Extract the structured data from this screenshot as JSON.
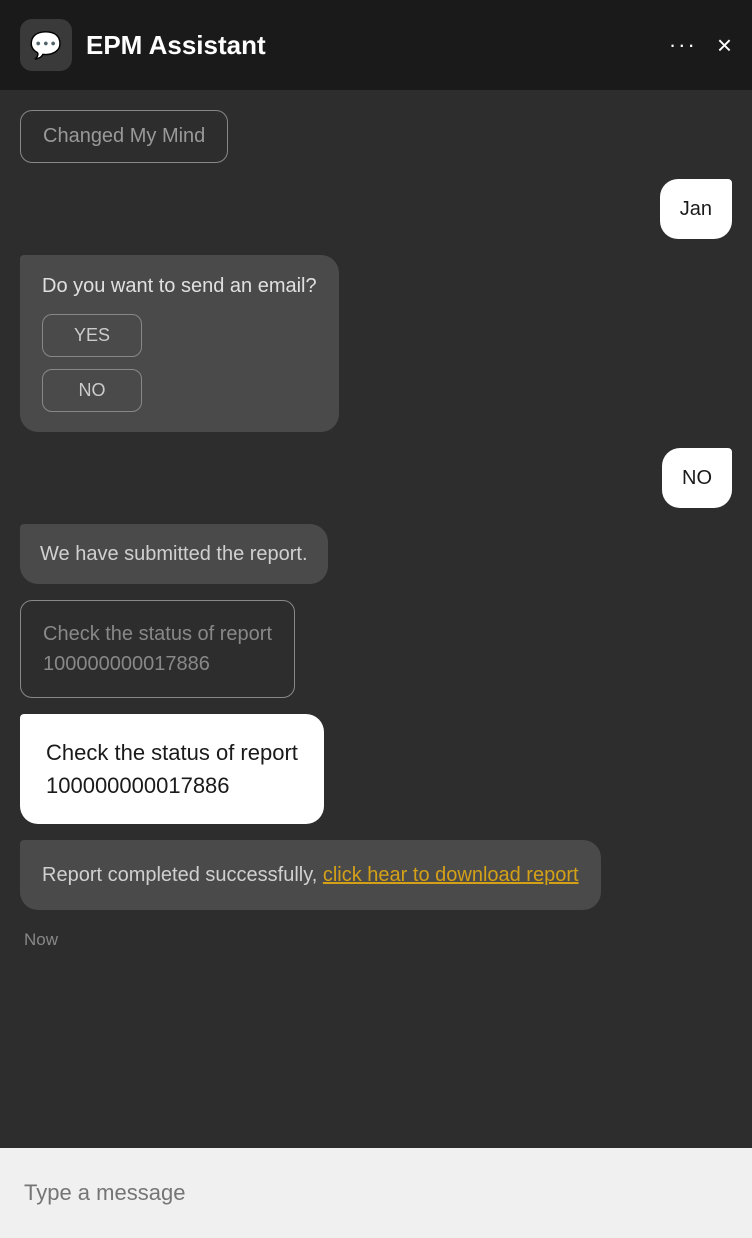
{
  "header": {
    "title": "EPM Assistant",
    "icon_label": "chat-icon",
    "dots_label": "···",
    "close_label": "×"
  },
  "messages": [
    {
      "id": "changed-mind",
      "type": "user-button",
      "text": "Changed My Mind",
      "side": "left"
    },
    {
      "id": "jan-reply",
      "type": "user-bubble",
      "text": "Jan",
      "side": "right"
    },
    {
      "id": "email-question",
      "type": "assistant-question",
      "question": "Do you want to send an email?",
      "options": [
        "YES",
        "NO"
      ],
      "side": "left"
    },
    {
      "id": "no-reply",
      "type": "user-bubble",
      "text": "NO",
      "side": "right"
    },
    {
      "id": "submitted-report",
      "type": "assistant-bubble",
      "text": "We have submitted the report.",
      "side": "left"
    },
    {
      "id": "check-status-outlined",
      "type": "outlined-box",
      "line1": "Check the status of report",
      "line2": "100000000017886",
      "side": "left"
    },
    {
      "id": "check-status-white",
      "type": "white-bubble",
      "line1": "Check the status of report",
      "line2": "100000000017886",
      "side": "left"
    },
    {
      "id": "report-completed",
      "type": "assistant-link-bubble",
      "text_before": "Report completed successfully, ",
      "link_text": "click hear to download report",
      "side": "left"
    }
  ],
  "timestamp": "Now",
  "input": {
    "placeholder": "Type a message"
  }
}
